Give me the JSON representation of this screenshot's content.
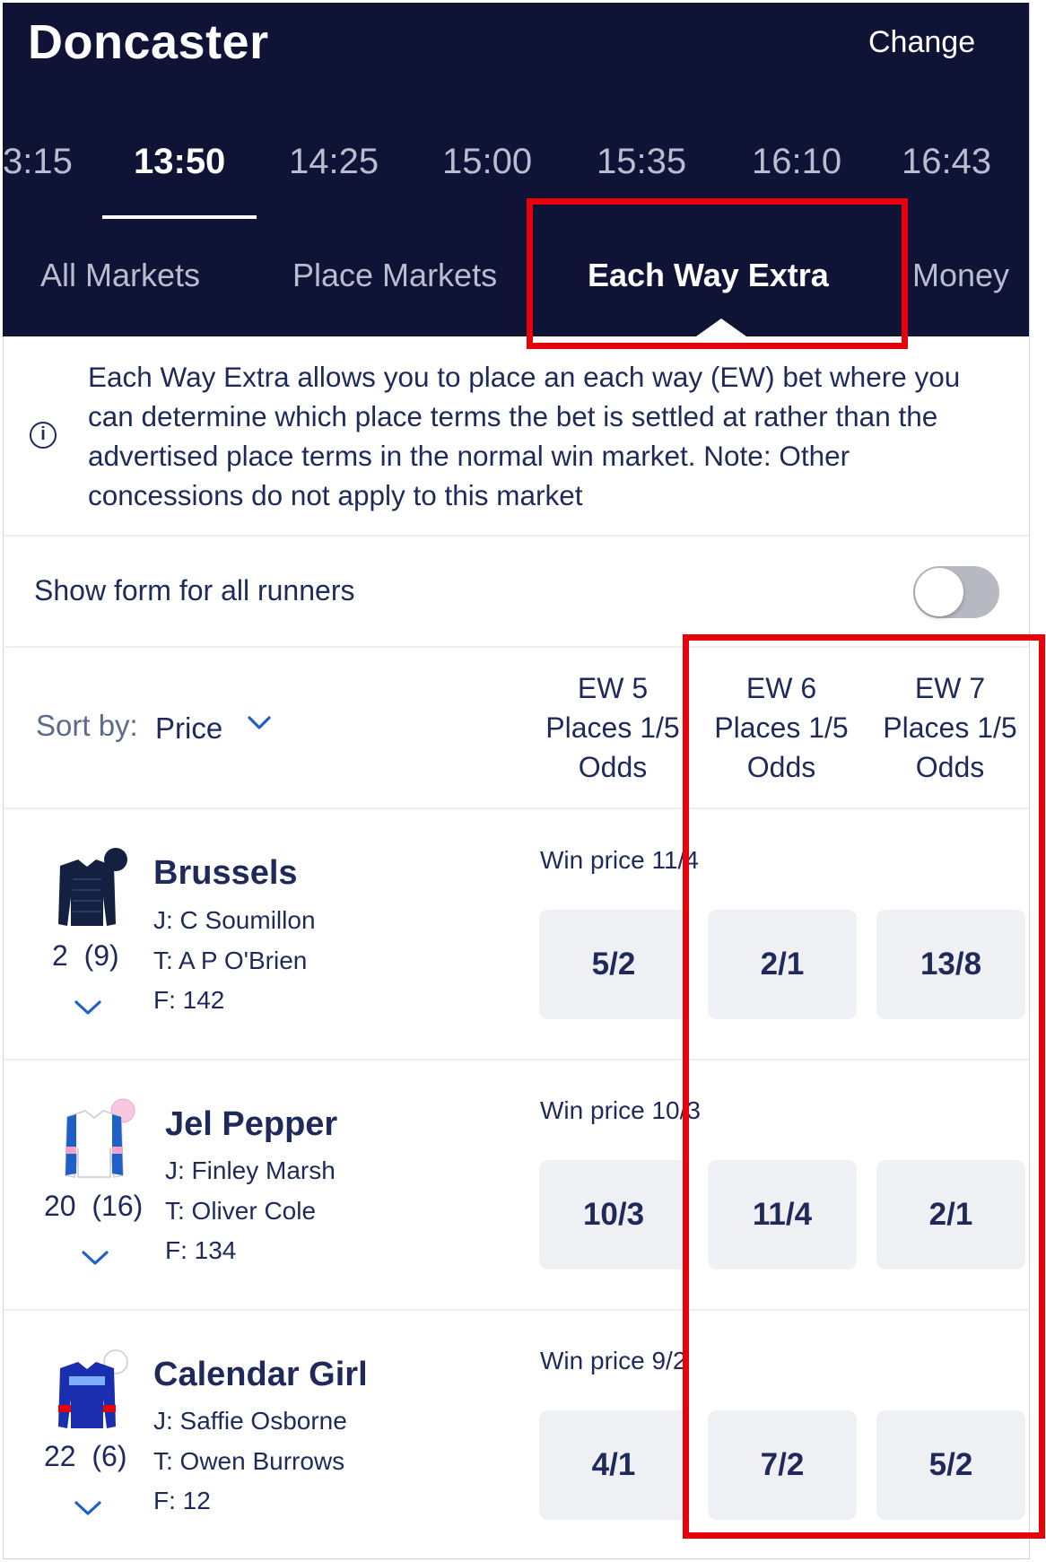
{
  "header": {
    "venue": "Doncaster",
    "change_label": "Change",
    "race_times": [
      "3:15",
      "13:50",
      "14:25",
      "15:00",
      "15:35",
      "16:10",
      "16:43"
    ],
    "active_time": "13:50",
    "market_tabs": [
      "All Markets",
      "Place Markets",
      "Each Way Extra",
      "Money"
    ],
    "active_market_tab": "Each Way Extra"
  },
  "info": {
    "icon": "info-icon",
    "text": "Each Way Extra allows you to place an each way (EW) bet where you can determine which place terms the bet is settled at rather than the advertised place terms in the normal win market. Note: Other concessions do not apply to this market"
  },
  "form_toggle": {
    "label": "Show form for all runners",
    "on": false
  },
  "sort": {
    "label": "Sort by:",
    "value": "Price"
  },
  "columns": [
    {
      "line1": "EW 5",
      "line2": "Places 1/5",
      "line3": "Odds"
    },
    {
      "line1": "EW 6",
      "line2": "Places 1/5",
      "line3": "Odds"
    },
    {
      "line1": "EW 7",
      "line2": "Places 1/5",
      "line3": "Odds"
    }
  ],
  "runners": [
    {
      "name": "Brussels",
      "number": "2",
      "draw": "(9)",
      "jockey": "J: C Soumillon",
      "trainer": "T: A P O'Brien",
      "form": "F: 142",
      "win_price": "Win price 11/4",
      "odds": [
        "5/2",
        "2/1",
        "13/8"
      ]
    },
    {
      "name": "Jel Pepper",
      "number": "20",
      "draw": "(16)",
      "jockey": "J: Finley Marsh",
      "trainer": "T: Oliver Cole",
      "form": "F: 134",
      "win_price": "Win price 10/3",
      "odds": [
        "10/3",
        "11/4",
        "2/1"
      ]
    },
    {
      "name": "Calendar Girl",
      "number": "22",
      "draw": "(6)",
      "jockey": "J: Saffie Osborne",
      "trainer": "T: Owen Burrows",
      "form": "F: 12",
      "win_price": "Win price 9/2",
      "odds": [
        "4/1",
        "7/2",
        "5/2"
      ]
    }
  ],
  "colors": {
    "header_bg": "#0f1437",
    "text_navy": "#1f2a5a",
    "odds_bg": "#eef0f3",
    "highlight_red": "#e8000b"
  }
}
